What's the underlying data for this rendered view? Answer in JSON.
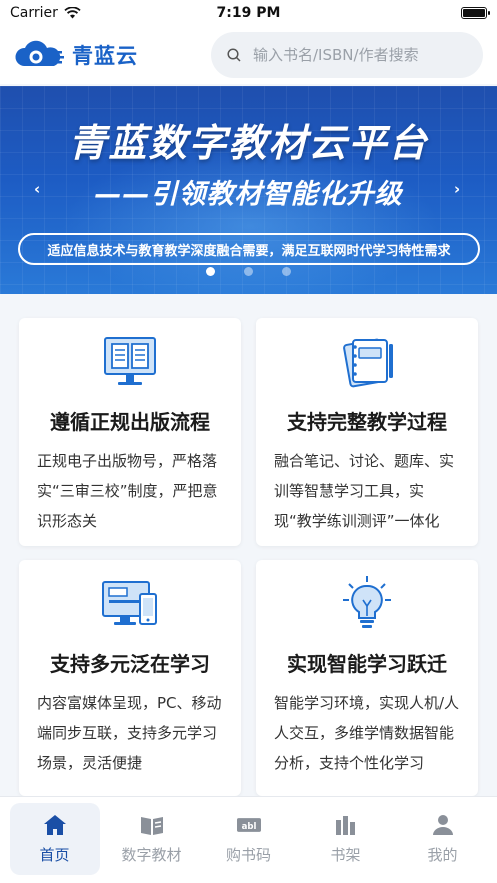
{
  "status_bar": {
    "carrier": "Carrier",
    "time": "7:19 PM"
  },
  "header": {
    "logo_text": "青蓝云",
    "search_placeholder": "输入书名/ISBN/作者搜索"
  },
  "banner": {
    "title": "青蓝数字教材云平台",
    "subtitle": "——引领教材智能化升级",
    "pill_text": "适应信息技术与教育教学深度融合需要，满足互联网时代学习特性需求",
    "slide_count": 3,
    "active_slide": 1
  },
  "cards": [
    {
      "title": "遵循正规出版流程",
      "desc": "正规电子出版物号，严格落实“三审三校”制度，严把意识形态关",
      "icon": "book-screen-icon"
    },
    {
      "title": "支持完整教学过程",
      "desc": "融合笔记、讨论、题库、实训等智慧学习工具，实现“教学练训测评”一体化",
      "icon": "notebook-icon"
    },
    {
      "title": "支持多元泛在学习",
      "desc": "内容富媒体呈现，PC、移动端同步互联，支持多元学习场景，灵活便捷",
      "icon": "devices-icon"
    },
    {
      "title": "实现智能学习跃迁",
      "desc": "智能学习环境，实现人机/人人交互，多维学情数据智能分析，支持个性化学习",
      "icon": "lightbulb-icon"
    }
  ],
  "tabs": [
    {
      "label": "首页",
      "icon": "home-icon",
      "active": true
    },
    {
      "label": "数字教材",
      "icon": "open-book-icon",
      "active": false
    },
    {
      "label": "购书码",
      "icon": "code-label-icon",
      "icon_text": "abl",
      "active": false
    },
    {
      "label": "书架",
      "icon": "bookshelf-icon",
      "active": false
    },
    {
      "label": "我的",
      "icon": "profile-icon",
      "active": false
    }
  ],
  "colors": {
    "brand": "#1a62c7",
    "active_tab": "#1a4fa6",
    "inactive_tab": "#9aa0a8"
  }
}
